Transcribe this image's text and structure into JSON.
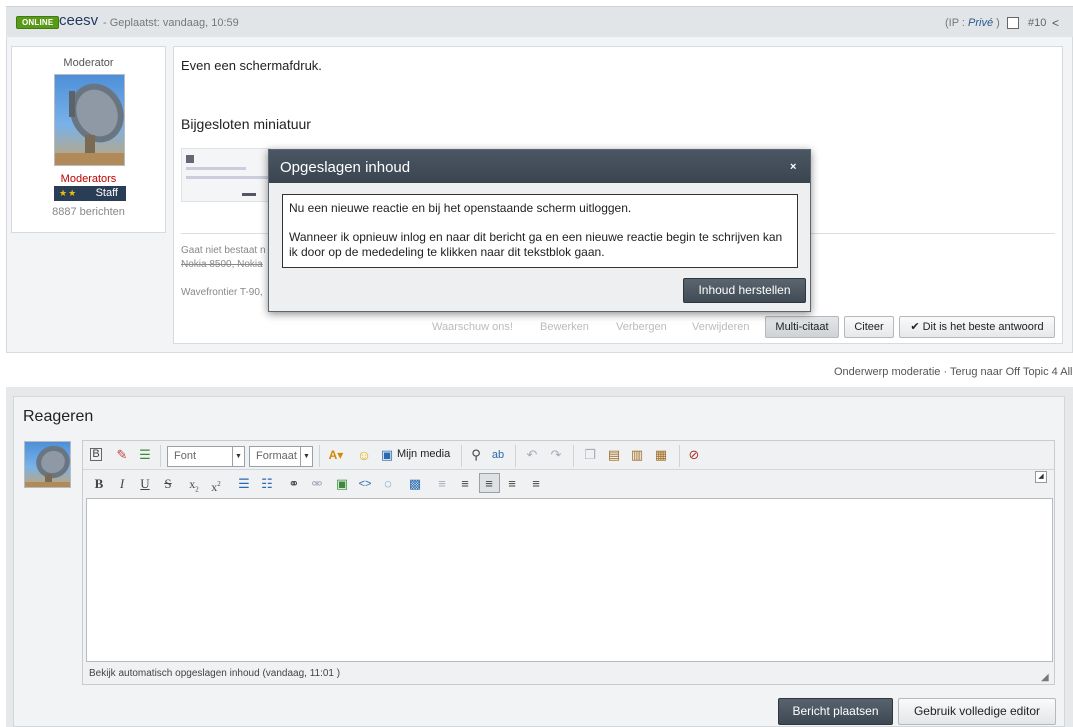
{
  "post": {
    "online_label": "ONLINE",
    "username": "ceesv",
    "posted": "- Geplaatst: vandaag, 10:59",
    "ip_prefix": "(IP : ",
    "ip_value": "Privé",
    "ip_suffix": " )",
    "number": "#10",
    "user": {
      "title": "Moderator",
      "group": "Moderators",
      "stars": "★★",
      "staff_label": "Staff",
      "post_count": "8887 berichten"
    },
    "content_line1": "Even een schermafdruk.",
    "content_line2": "Bijgesloten miniatuur",
    "signature_line1_visible": "Gaat niet bestaat n",
    "signature_line2_visible": "Nokia 8500, Nokia",
    "signature_line3_visible": "Wavefrontier T-90,",
    "actions": {
      "report": "Waarschuw ons!",
      "edit": "Bewerken",
      "hide": "Verbergen",
      "delete": "Verwijderen",
      "multi_quote": "Multi-citaat",
      "quote": "Citeer",
      "best_answer": "Dit is het beste antwoord"
    }
  },
  "modal": {
    "title": "Opgeslagen inhoud",
    "close": "×",
    "text_para1": "Nu een nieuwe reactie en bij het openstaande scherm uitloggen.",
    "text_para2": "Wanneer ik opnieuw inlog en naar dit bericht ga en een nieuwe reactie begin te schrijven kan ik door op de mededeling te klikken naar dit tekstblok gaan.",
    "restore_button": "Inhoud herstellen"
  },
  "moderation_links": {
    "moderation": "Onderwerp moderatie",
    "separator": " · ",
    "back": "Terug naar Off Topic 4 All"
  },
  "reply": {
    "heading": "Reageren",
    "toolbar": {
      "font_select": "Font",
      "format_select": "Formaat",
      "mijn_media": "Mijn media"
    },
    "status": "Bekijk automatisch opgeslagen inhoud (vandaag, 11:01 )",
    "post_button": "Bericht plaatsen",
    "full_editor_button": "Gebruik volledige editor"
  },
  "colors": {
    "accent_dark": "#3a4550",
    "online_green": "#5a9a19",
    "moderator_red": "#c00000"
  }
}
